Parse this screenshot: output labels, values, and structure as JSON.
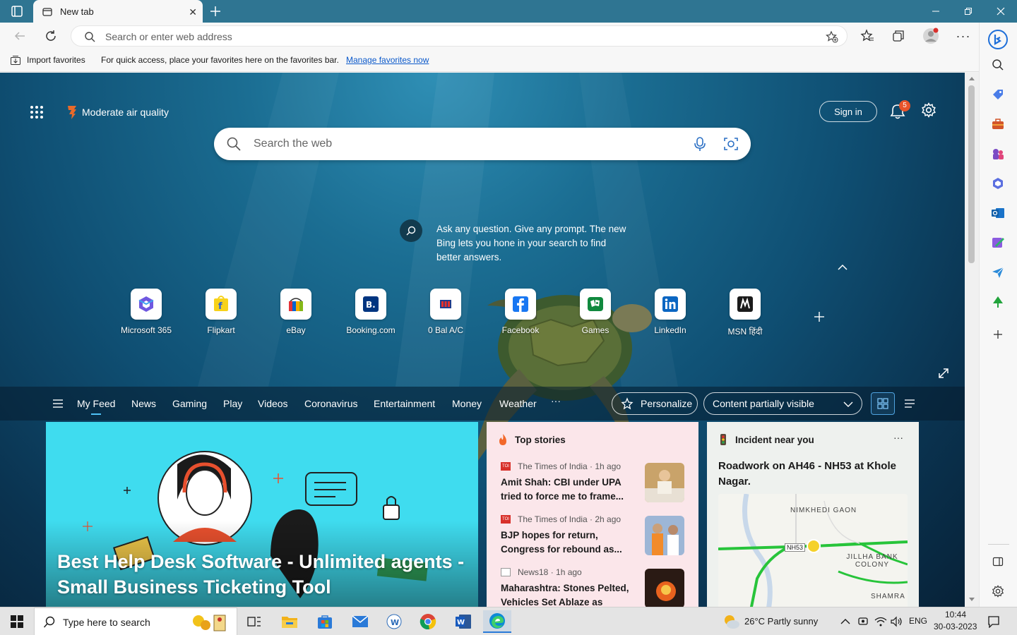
{
  "browser": {
    "tab_title": "New tab",
    "address_placeholder": "Search or enter web address",
    "favorites_bar": {
      "import_label": "Import favorites",
      "message": "For quick access, place your favorites here on the favorites bar.",
      "manage_link": "Manage favorites now"
    }
  },
  "newtab": {
    "air_quality": "Moderate air quality",
    "sign_in": "Sign in",
    "notifications_count": "5",
    "search_placeholder": "Search the web",
    "bing_tip": "Ask any question. Give any prompt. The new Bing lets you hone in your search to find better answers.",
    "quick_links": [
      {
        "label": "Microsoft 365",
        "icon": "microsoft365-icon"
      },
      {
        "label": "Flipkart",
        "icon": "flipkart-icon"
      },
      {
        "label": "eBay",
        "icon": "ebay-icon"
      },
      {
        "label": "Booking.com",
        "icon": "booking-icon"
      },
      {
        "label": "0 Bal A/C",
        "icon": "bank-icon"
      },
      {
        "label": "Facebook",
        "icon": "facebook-icon"
      },
      {
        "label": "Games",
        "icon": "games-icon"
      },
      {
        "label": "LinkedIn",
        "icon": "linkedin-icon"
      },
      {
        "label": "MSN हिंदी",
        "icon": "msn-icon"
      }
    ],
    "feed_nav": {
      "items": [
        "My Feed",
        "News",
        "Gaming",
        "Play",
        "Videos",
        "Coronavirus",
        "Entertainment",
        "Money",
        "Weather"
      ],
      "more": "···",
      "personalize": "Personalize",
      "content_visibility": "Content partially visible"
    },
    "hero_card": {
      "title": "Best Help Desk Software - Unlimited agents - Small Business Ticketing Tool"
    },
    "top_stories": {
      "header": "Top stories",
      "stories": [
        {
          "source": "The Times of India · 1h ago",
          "headline": "Amit Shah: CBI under UPA tried to force me to frame..."
        },
        {
          "source": "The Times of India · 2h ago",
          "headline": "BJP hopes for return, Congress for rebound as..."
        },
        {
          "source": "News18 · 1h ago",
          "headline": "Maharashtra: Stones Pelted, Vehicles Set Ablaze as Clash..."
        }
      ]
    },
    "incident": {
      "header": "Incident near you",
      "more": "···",
      "title": "Roadwork on AH46 - NH53 at Khole Nagar.",
      "map_labels": [
        "NIMKHEDI GAON",
        "NH53",
        "JILLHA BANK COLONY",
        "SHAMRA"
      ]
    }
  },
  "taskbar": {
    "search_placeholder": "Type here to search",
    "weather": "26°C  Partly sunny",
    "language": "ENG",
    "time": "10:44",
    "date": "30-03-2023"
  },
  "colors": {
    "titlebar": "#2f7592",
    "accent": "#0a58ca",
    "hero_bg": "#3fdcef",
    "stories_bg": "#fbe6ea"
  }
}
